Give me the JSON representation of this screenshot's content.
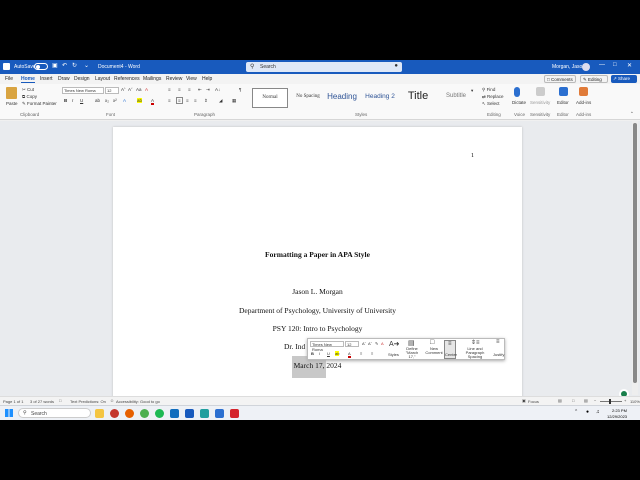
{
  "titlebar": {
    "autosave": "AutoSave",
    "autosave_state": "Off",
    "doc_title": "Document4 - Word",
    "search_placeholder": "Search",
    "user": "Morgan, Jason"
  },
  "menu": {
    "tabs": [
      "File",
      "Home",
      "Insert",
      "Draw",
      "Design",
      "Layout",
      "References",
      "Mailings",
      "Review",
      "View",
      "Help"
    ],
    "active": "Home",
    "comments": "Comments",
    "editing": "Editing",
    "share": "Share"
  },
  "ribbon": {
    "paste": "Paste",
    "cut": "Cut",
    "copy": "Copy",
    "format_painter": "Format Painter",
    "clipboard": "Clipboard",
    "font_name": "Times New Roma",
    "font_size": "12",
    "font_group": "Font",
    "paragraph_group": "Paragraph",
    "styles": [
      "Normal",
      "No Spacing",
      "Heading",
      "Heading 2",
      "Title",
      "Subtitle"
    ],
    "styles_group": "Styles",
    "find": "Find",
    "replace": "Replace",
    "select": "Select",
    "editing_group": "Editing",
    "dictate": "Dictate",
    "voice_group": "Voice",
    "sensitivity": "Sensitivity",
    "sensitivity_group": "Sensitivity",
    "editor": "Editor",
    "editor_group": "Editor",
    "addins": "Add-ins",
    "addins_group": "Add-ins"
  },
  "document": {
    "page_number": "1",
    "title": "Formatting a Paper in APA Style",
    "author": "Jason L. Morgan",
    "department": "Department of Psychology, University of University",
    "course": "PSY 120: Intro to Psychology",
    "instructor": "Dr. Ind",
    "date": "March 17, 2024"
  },
  "minitoolbar": {
    "font_name": "Times New Roma",
    "font_size": "12",
    "styles": "Styles",
    "define": "Define \"March 17,\"",
    "new_comment": "New Comment",
    "center": "Center",
    "line_spacing": "Line and Paragraph Spacing",
    "justify": "Justify"
  },
  "status": {
    "page": "Page 1 of 1",
    "words": "3 of 27 words",
    "text_predictions": "Text Predictions: On",
    "accessibility": "Accessibility: Good to go",
    "focus": "Focus",
    "zoom": "110%"
  },
  "taskbar": {
    "search": "Search",
    "time": "2:23 PM",
    "date": "12/29/2023"
  },
  "colors": {
    "word_blue": "#185abd",
    "selection": "#c8c8c8"
  }
}
